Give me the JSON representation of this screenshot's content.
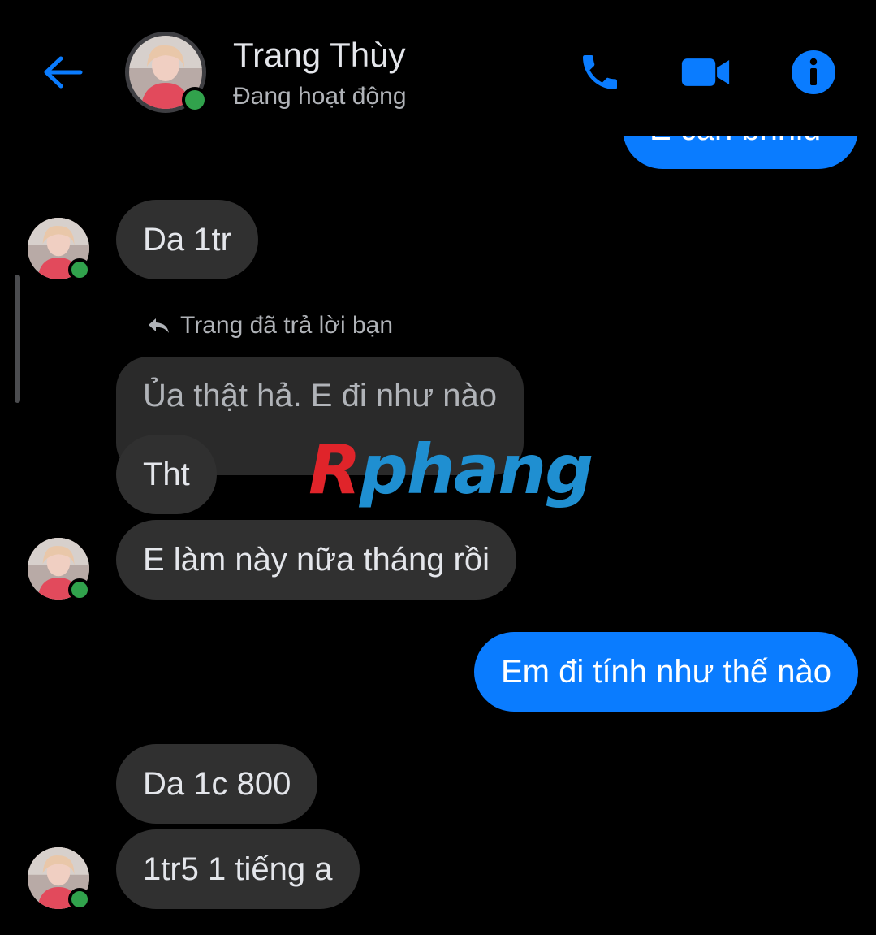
{
  "header": {
    "contact_name": "Trang Thùy",
    "status": "Đang hoạt động",
    "back_icon": "arrow-left-icon",
    "call_icon": "phone-icon",
    "video_icon": "video-camera-icon",
    "info_icon": "info-icon"
  },
  "colors": {
    "accent": "#0a7cff",
    "incoming_bubble": "#303030",
    "online": "#31a24c",
    "background": "#000000"
  },
  "messages": {
    "top_partial": "E cần bnhiu",
    "m1": "Da 1tr",
    "reply_note": "Trang đã trả lời bạn",
    "m2_quoted": "Ủa thật hả. E đi như nào",
    "m3": "Tht",
    "m4": "E làm này nữa tháng rồi",
    "m5": "Em đi tính như thế nào",
    "m6": "Da 1c 800",
    "m7": "1tr5 1 tiếng a"
  },
  "watermark": {
    "first": "R",
    "rest": "phang"
  }
}
